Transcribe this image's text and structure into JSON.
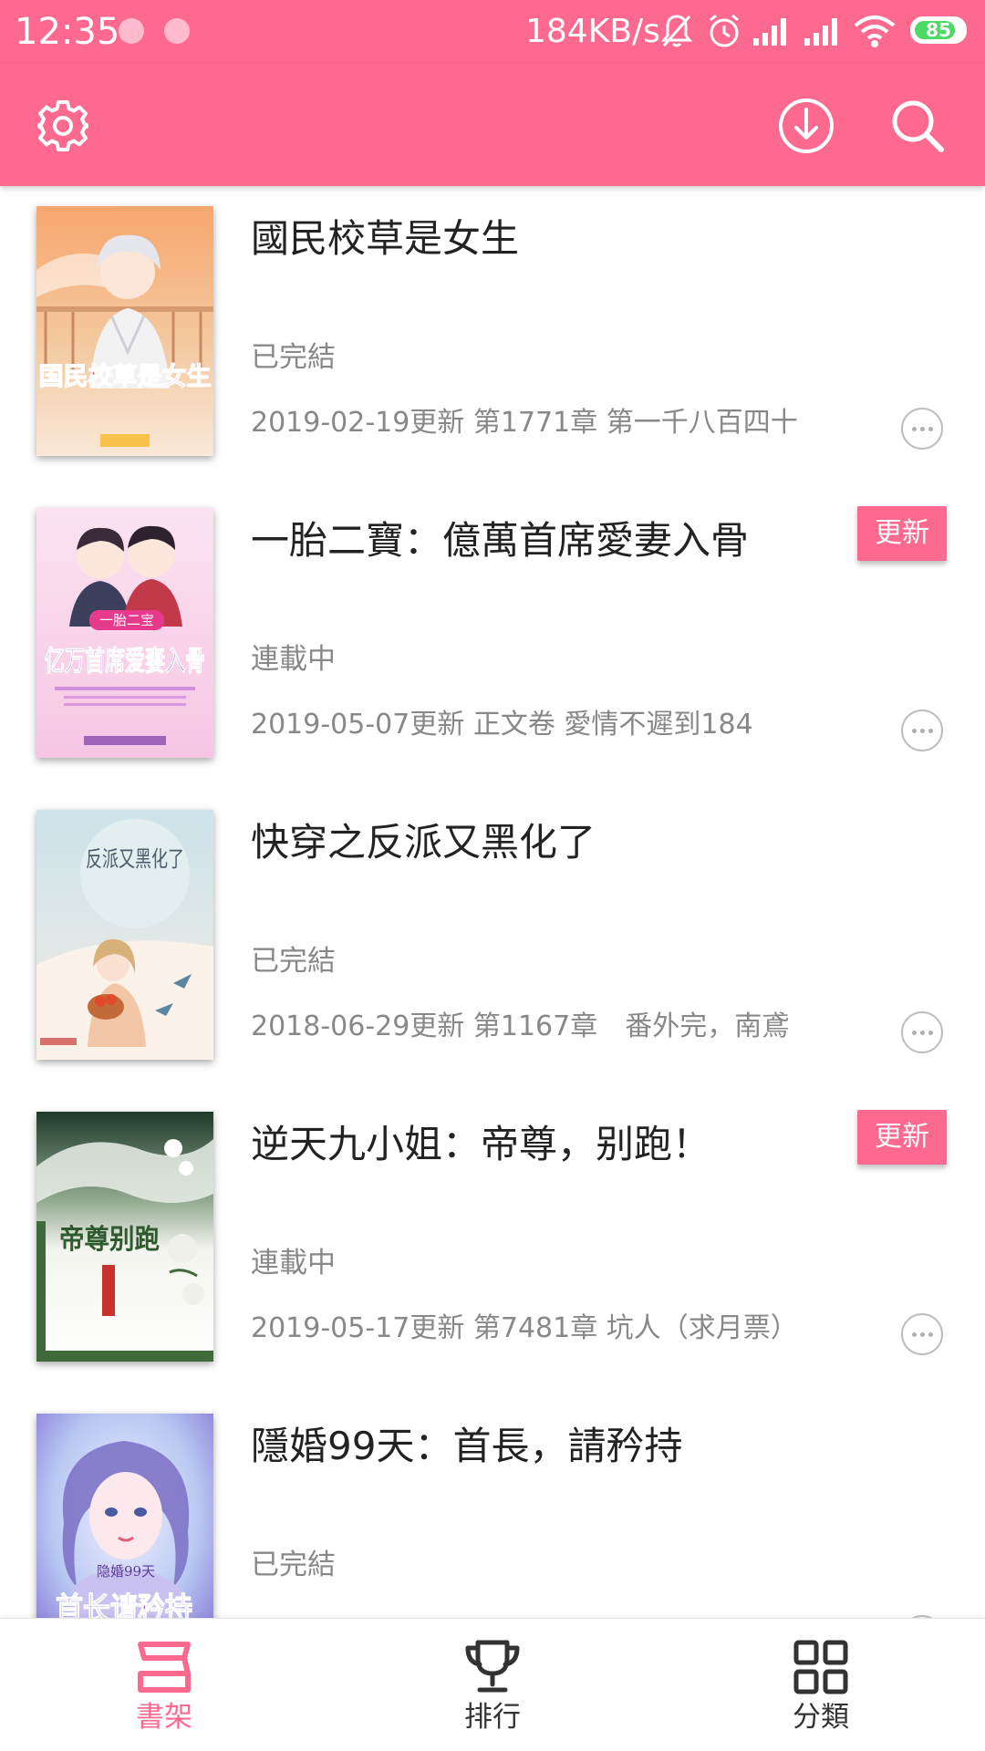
{
  "status_bar": {
    "time": "12:35",
    "speed": "184KB/s",
    "battery": "85",
    "battery_level": 0.85,
    "icons": [
      "mute-icon",
      "alarm-icon",
      "signal-icon",
      "signal-icon",
      "wifi-icon",
      "battery-icon"
    ]
  },
  "app_bar": {
    "icons": [
      "settings-icon",
      "download-icon",
      "search-icon"
    ]
  },
  "theme": {
    "accent": "#fe6990",
    "text_primary": "#222222",
    "text_secondary": "#888888"
  },
  "books": [
    {
      "title": "國民校草是女生",
      "status": "已完結",
      "latest": "2019-02-19更新 第1771章 第一千八百四十",
      "badge": "",
      "cover_title": "国民校草是女生"
    },
    {
      "title": "一胎二寶：億萬首席愛妻入骨",
      "status": "連載中",
      "latest": "2019-05-07更新 正文卷 愛情不遲到184",
      "badge": "更新",
      "cover_title": "亿万首席爱妻入骨"
    },
    {
      "title": "快穿之反派又黑化了",
      "status": "已完結",
      "latest": "2018-06-29更新 第1167章　番外完，南鳶",
      "badge": "",
      "cover_title": "反派又黑化了"
    },
    {
      "title": "逆天九小姐：帝尊，别跑！",
      "status": "連載中",
      "latest": "2019-05-17更新 第7481章 坑人（求月票）",
      "badge": "更新",
      "cover_title": "帝尊别跑"
    },
    {
      "title": "隱婚99天：首長，請矜持",
      "status": "已完結",
      "latest": "",
      "badge": "",
      "cover_title": "首长请矜持"
    }
  ],
  "bottom_nav": {
    "items": [
      {
        "label": "書架",
        "icon": "bookshelf-icon",
        "active": true
      },
      {
        "label": "排行",
        "icon": "trophy-icon",
        "active": false
      },
      {
        "label": "分類",
        "icon": "grid-icon",
        "active": false
      }
    ]
  }
}
